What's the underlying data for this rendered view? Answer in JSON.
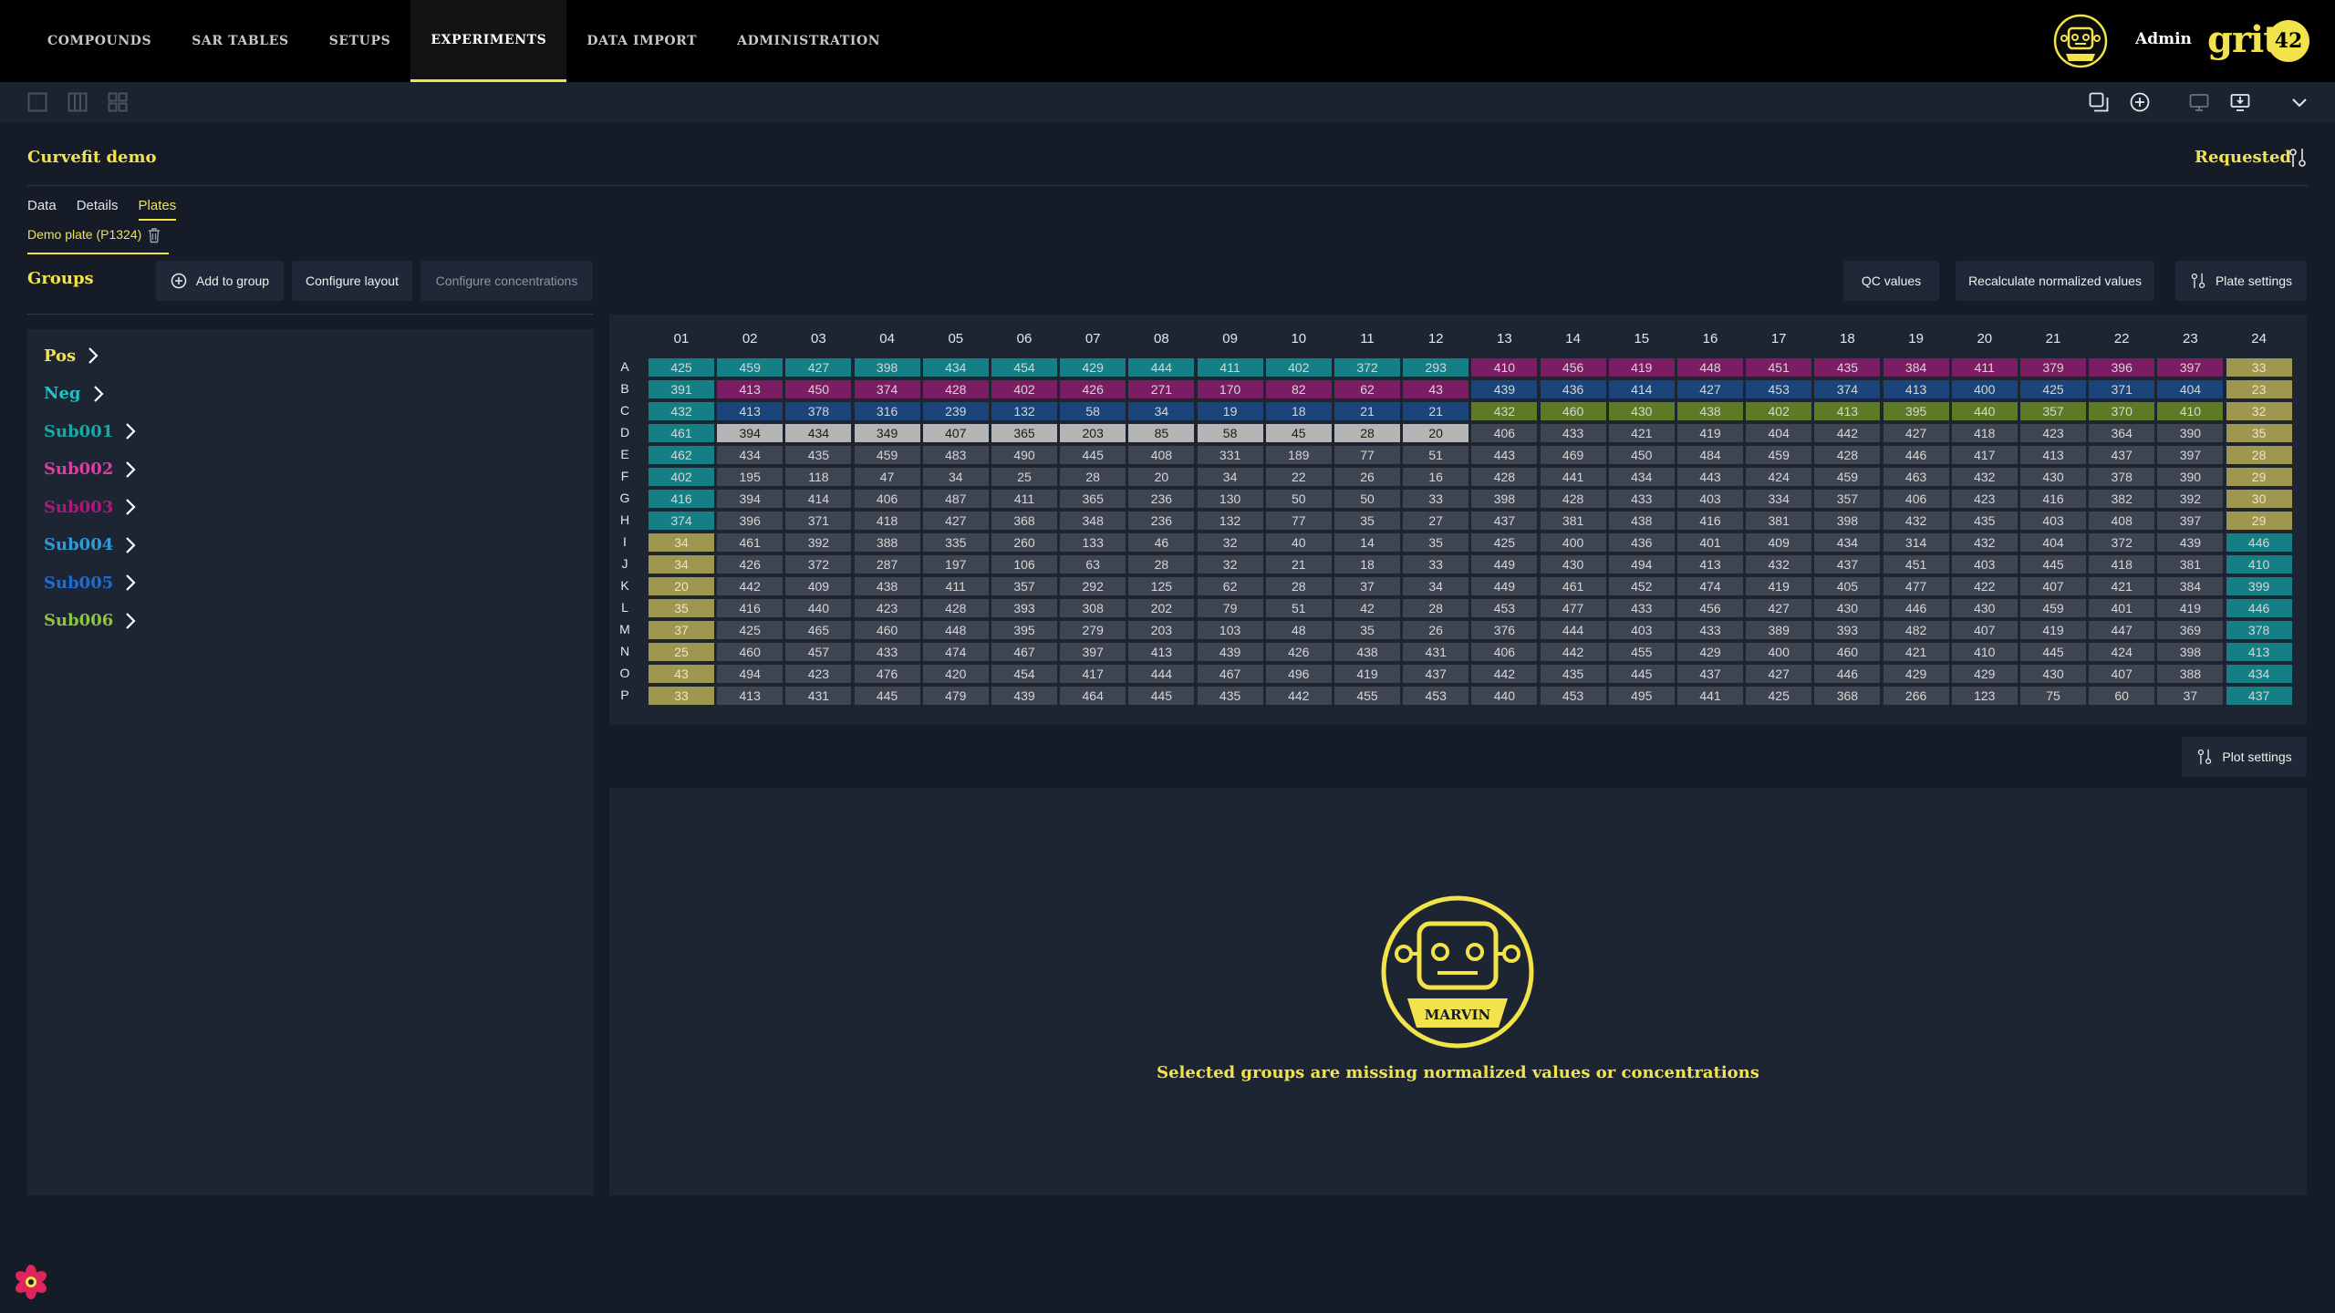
{
  "nav": {
    "items": [
      "COMPOUNDS",
      "SAR TABLES",
      "SETUPS",
      "EXPERIMENTS",
      "DATA IMPORT",
      "ADMINISTRATION"
    ],
    "active_index": 3,
    "user": "Admin",
    "logo_text": "grit",
    "logo_badge": "42"
  },
  "toolbar": {
    "left_icons": [
      "single-panel-icon",
      "three-columns-icon",
      "grid-icon"
    ],
    "right_icons": [
      "duplicate-icon",
      "add-circle-icon",
      "monitor-icon",
      "monitor-download-icon",
      "chevron-down-icon"
    ]
  },
  "experiment": {
    "title": "Curvefit demo",
    "status": "Requested",
    "tabs": [
      "Data",
      "Details",
      "Plates"
    ],
    "active_tab": "Plates",
    "plate_tab": "Demo plate (P1324)"
  },
  "groups": {
    "title": "Groups",
    "buttons": {
      "add": "Add to group",
      "configure_layout": "Configure layout",
      "configure_concentrations": "Configure concentrations"
    },
    "items": [
      {
        "label": "Pos",
        "color": "#f2e34a"
      },
      {
        "label": "Neg",
        "color": "#1fc2c8"
      },
      {
        "label": "Sub001",
        "color": "#17a9a4"
      },
      {
        "label": "Sub002",
        "color": "#e23ba1"
      },
      {
        "label": "Sub003",
        "color": "#b0177e"
      },
      {
        "label": "Sub004",
        "color": "#2c9cd8"
      },
      {
        "label": "Sub005",
        "color": "#1e6bd1"
      },
      {
        "label": "Sub006",
        "color": "#8cc43c"
      }
    ]
  },
  "plate_actions": {
    "qc": "QC values",
    "recalc": "Recalculate normalized values",
    "settings": "Plate settings"
  },
  "plate": {
    "columns": [
      "01",
      "02",
      "03",
      "04",
      "05",
      "06",
      "07",
      "08",
      "09",
      "10",
      "11",
      "12",
      "13",
      "14",
      "15",
      "16",
      "17",
      "18",
      "19",
      "20",
      "21",
      "22",
      "23",
      "24"
    ],
    "rows": [
      "A",
      "B",
      "C",
      "D",
      "E",
      "F",
      "G",
      "H",
      "I",
      "J",
      "K",
      "L",
      "M",
      "N",
      "O",
      "P"
    ],
    "values": [
      [
        425,
        459,
        427,
        398,
        434,
        454,
        429,
        444,
        411,
        402,
        372,
        293,
        410,
        456,
        419,
        448,
        451,
        435,
        384,
        411,
        379,
        396,
        397,
        33
      ],
      [
        391,
        413,
        450,
        374,
        428,
        402,
        426,
        271,
        170,
        82,
        62,
        43,
        439,
        436,
        414,
        427,
        453,
        374,
        413,
        400,
        425,
        371,
        404,
        23
      ],
      [
        432,
        413,
        378,
        316,
        239,
        132,
        58,
        34,
        19,
        18,
        21,
        21,
        432,
        460,
        430,
        438,
        402,
        413,
        395,
        440,
        357,
        370,
        410,
        32
      ],
      [
        461,
        394,
        434,
        349,
        407,
        365,
        203,
        85,
        58,
        45,
        28,
        20,
        406,
        433,
        421,
        419,
        404,
        442,
        427,
        418,
        423,
        364,
        390,
        35
      ],
      [
        462,
        434,
        435,
        459,
        483,
        490,
        445,
        408,
        331,
        189,
        77,
        51,
        443,
        469,
        450,
        484,
        459,
        428,
        446,
        417,
        413,
        437,
        397,
        28
      ],
      [
        402,
        195,
        118,
        47,
        34,
        25,
        28,
        20,
        34,
        22,
        26,
        16,
        428,
        441,
        434,
        443,
        424,
        459,
        463,
        432,
        430,
        378,
        390,
        29
      ],
      [
        416,
        394,
        414,
        406,
        487,
        411,
        365,
        236,
        130,
        50,
        50,
        33,
        398,
        428,
        433,
        403,
        334,
        357,
        406,
        423,
        416,
        382,
        392,
        30
      ],
      [
        374,
        396,
        371,
        418,
        427,
        368,
        348,
        236,
        132,
        77,
        35,
        27,
        437,
        381,
        438,
        416,
        381,
        398,
        432,
        435,
        403,
        408,
        397,
        29
      ],
      [
        34,
        461,
        392,
        388,
        335,
        260,
        133,
        46,
        32,
        40,
        14,
        35,
        425,
        400,
        436,
        401,
        409,
        434,
        314,
        432,
        404,
        372,
        439,
        446
      ],
      [
        34,
        426,
        372,
        287,
        197,
        106,
        63,
        28,
        32,
        21,
        18,
        33,
        449,
        430,
        494,
        413,
        432,
        437,
        451,
        403,
        445,
        418,
        381,
        410
      ],
      [
        20,
        442,
        409,
        438,
        411,
        357,
        292,
        125,
        62,
        28,
        37,
        34,
        449,
        461,
        452,
        474,
        419,
        405,
        477,
        422,
        407,
        421,
        384,
        399
      ],
      [
        35,
        416,
        440,
        423,
        428,
        393,
        308,
        202,
        79,
        51,
        42,
        28,
        453,
        477,
        433,
        456,
        427,
        430,
        446,
        430,
        459,
        401,
        419,
        446
      ],
      [
        37,
        425,
        465,
        460,
        448,
        395,
        279,
        203,
        103,
        48,
        35,
        26,
        376,
        444,
        403,
        433,
        389,
        393,
        482,
        407,
        419,
        447,
        369,
        378
      ],
      [
        25,
        460,
        457,
        433,
        474,
        467,
        397,
        413,
        439,
        426,
        438,
        431,
        406,
        442,
        455,
        429,
        400,
        460,
        421,
        410,
        445,
        424,
        398,
        413
      ],
      [
        43,
        494,
        423,
        476,
        420,
        454,
        417,
        444,
        467,
        496,
        419,
        437,
        442,
        435,
        445,
        437,
        427,
        446,
        429,
        429,
        430,
        407,
        388,
        434
      ],
      [
        33,
        413,
        431,
        445,
        479,
        439,
        464,
        445,
        435,
        442,
        455,
        453,
        440,
        453,
        495,
        441,
        425,
        368,
        266,
        123,
        75,
        60,
        37,
        437
      ]
    ],
    "colors": {
      "teal": "#147f85",
      "magenta": "#7b1d62",
      "blue": "#1a447a",
      "olive": "#5d7a26",
      "light": "#b5b5b5",
      "khaki": "#9f9650",
      "grey": "#3e4450"
    }
  },
  "plot": {
    "settings_label": "Plot settings",
    "logo_text": "MARVIN",
    "message": "Selected groups are missing normalized values or concentrations"
  }
}
